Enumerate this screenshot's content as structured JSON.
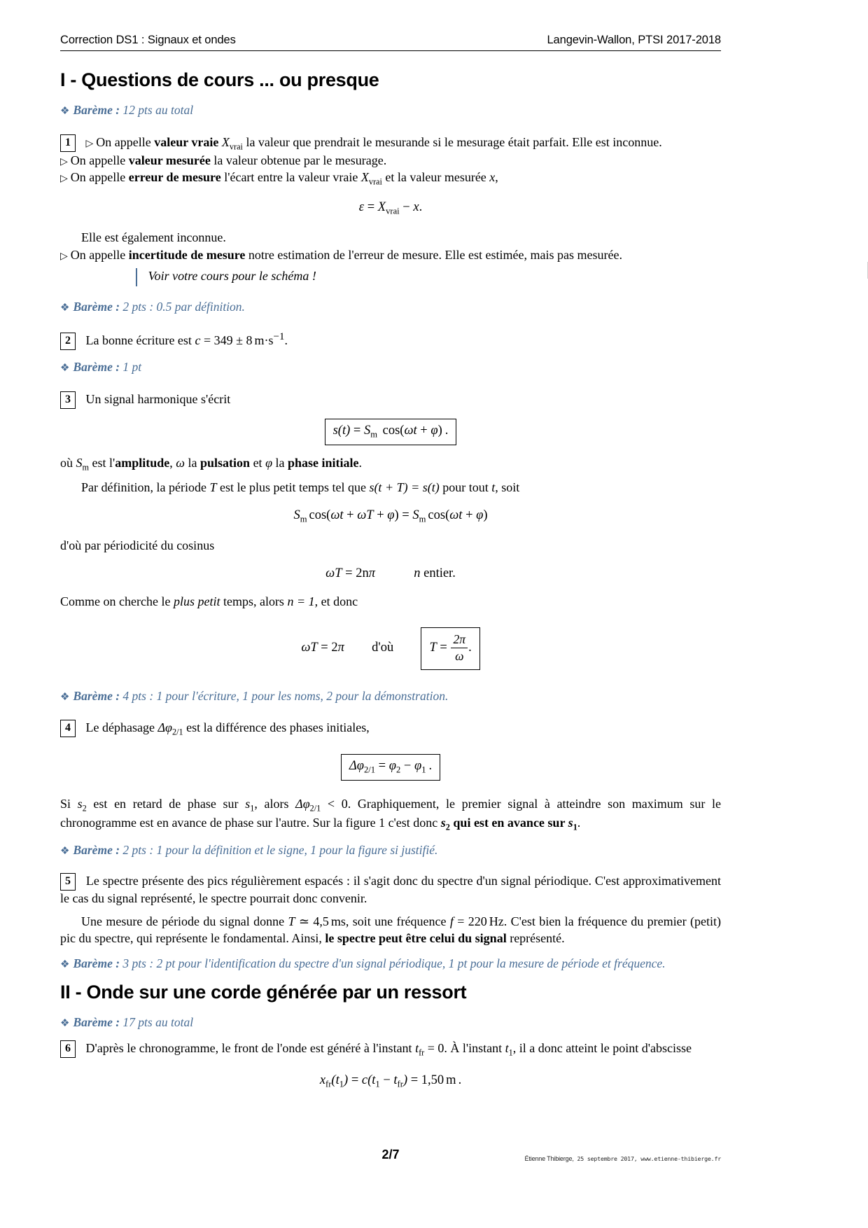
{
  "header": {
    "left": "Correction DS1 : Signaux et ondes",
    "right": "Langevin-Wallon, PTSI 2017-2018"
  },
  "sections": {
    "one": {
      "title": "I - Questions de cours ... ou presque",
      "bareme_total": {
        "label": "Barème :",
        "text": "12 pts au total"
      }
    },
    "two": {
      "title": "II - Onde sur une corde générée par un ressort",
      "bareme_total": {
        "label": "Barème :",
        "text": "17 pts au total"
      }
    }
  },
  "q1": {
    "number": "1",
    "line1_pre": "On appelle ",
    "line1_bold": "valeur vraie",
    "line1_post": " la valeur que prendrait le mesurande si le mesurage était parfait. Elle est inconnue.",
    "line1_sym_base": "X",
    "line1_sym_sub": "vrai",
    "line2_pre": "On appelle ",
    "line2_bold": "valeur mesurée",
    "line2_post": " la valeur obtenue par le mesurage.",
    "line3_pre": "On appelle ",
    "line3_bold": "erreur de mesure",
    "line3_mid": " l'écart entre la valeur vraie ",
    "line3_post": " et la valeur mesurée ",
    "line3_x": "x",
    "line3_end": ",",
    "equation": "ε = X_vrai − x .",
    "eq_eps": "ε",
    "eq_eq": "=",
    "eq_X": "X",
    "eq_Xsub": "vrai",
    "eq_minus": "−",
    "eq_x": "x",
    "eq_dot": ".",
    "after_eq": "Elle est également inconnue.",
    "line4_pre": "On appelle ",
    "line4_bold": "incertitude de mesure",
    "line4_post": " notre estimation de l'erreur de mesure. Elle est estimée, mais pas mesurée.",
    "callout": "Voir votre cours pour le schéma !",
    "bareme": {
      "label": "Barème :",
      "text": "2 pts : 0.5 par définition."
    }
  },
  "q2": {
    "number": "2",
    "text_pre": "La bonne écriture est ",
    "c": "c",
    "eq": "=",
    "value": "349 ± 8",
    "unit_m": "m",
    "unit_dot": "·",
    "unit_s": "s",
    "unit_exp": "−1",
    "period": ".",
    "bareme": {
      "label": "Barème :",
      "text": "1 pt"
    }
  },
  "q3": {
    "number": "3",
    "intro": "Un signal harmonique s'écrit",
    "boxed_eq": "s(t) = S_m cos(ωt + φ) .",
    "boxed": {
      "s": "s",
      "t1": "(t)",
      "eq": "=",
      "S": "S",
      "Ssub": "m",
      "cos": "cos(",
      "omega": "ω",
      "t2": "t",
      "plus": "+",
      "phi": "φ",
      "close": ")",
      "dot": "."
    },
    "where_pre": "où ",
    "where_S": "S",
    "where_Ssub": "m",
    "where_mid1": " est l'",
    "where_b1": "amplitude",
    "where_mid2": ", ",
    "where_omega": "ω",
    "where_mid3": " la ",
    "where_b2": "pulsation",
    "where_mid4": " et ",
    "where_phi": "φ",
    "where_mid5": " la ",
    "where_b3": "phase initiale",
    "where_end": ".",
    "def_pre": "Par définition, la période ",
    "def_T": "T",
    "def_mid": " est le plus petit temps tel que ",
    "def_eq": "s(t + T) = s(t)",
    "def_post": " pour tout ",
    "def_t": "t",
    "def_end": ", soit",
    "eq2": "S_m cos(ωt + ωT + φ) = S_m cos(ωt + φ)",
    "eq2_parts": {
      "S1": "S",
      "S1sub": "m",
      "cos1": "cos(",
      "w1": "ω",
      "t1": "t",
      "p1": "+",
      "w2": "ω",
      "T1": "T",
      "p2": "+",
      "phi1": "φ",
      "c1": ")",
      "eqs": "=",
      "S2": "S",
      "S2sub": "m",
      "cos2": "cos(",
      "w3": "ω",
      "t2": "t",
      "p3": "+",
      "phi2": "φ",
      "c2": ")"
    },
    "periodicity": "d'où par périodicité du cosinus",
    "eq3": "ωT = 2nπ        n entier.",
    "eq3_parts": {
      "w": "ω",
      "T": "T",
      "eq": "=",
      "val": "2n",
      "pi": "π",
      "n": "n",
      "entier": "entier."
    },
    "smallest_pre": "Comme on cherche le ",
    "smallest_it": "plus petit",
    "smallest_mid": " temps, alors ",
    "smallest_n": "n = 1",
    "smallest_end": ", et donc",
    "eq4_parts": {
      "w": "ω",
      "T": "T",
      "eq": "=",
      "val": "2",
      "pi": "π",
      "dou": "d'où",
      "Tb": "T",
      "eqb": "=",
      "num": "2π",
      "den": "ω",
      "dot": "."
    },
    "bareme": {
      "label": "Barème :",
      "text": "4 pts : 1 pour l'écriture, 1 pour les noms, 2 pour la démonstration."
    }
  },
  "q4": {
    "number": "4",
    "intro_pre": "Le déphasage ",
    "intro_sym": "Δφ",
    "intro_sub": "2/1",
    "intro_post": " est la différence des phases initiales,",
    "boxed_eq": "Δφ_2/1 = φ_2 − φ_1 .",
    "boxed": {
      "dphi": "Δφ",
      "dsub": "2/1",
      "eq": "=",
      "phi2": "φ",
      "sub2": "2",
      "minus": "−",
      "phi1": "φ",
      "sub1": "1",
      "dot": "."
    },
    "para": "Si s2 est en retard de phase sur s1, alors Δφ2/1 < 0. Graphiquement, le premier signal à atteindre son maximum sur le chronogramme est en avance de phase sur l'autre. Sur la figure 1 c'est donc s2 qui est en avance sur s1.",
    "p_pre": "Si ",
    "p_s2": "s",
    "p_s2sub": "2",
    "p_mid1": " est en retard de phase sur ",
    "p_s1": "s",
    "p_s1sub": "1",
    "p_mid2": ", alors ",
    "p_dphi": "Δφ",
    "p_dsub": "2/1",
    "p_lt": " < 0",
    "p_mid3": ". Graphiquement, le premier signal à atteindre son maximum sur le chronogramme est en avance de phase sur l'autre. Sur la figure 1 c'est donc ",
    "p_b_s2": "s",
    "p_b_s2sub": "2",
    "p_b_mid": " qui est en avance sur ",
    "p_b_s1": "s",
    "p_b_s1sub": "1",
    "p_end": ".",
    "bareme": {
      "label": "Barème :",
      "text": "2 pts : 1 pour la définition et le signe, 1 pour la figure si justifié."
    }
  },
  "q5": {
    "number": "5",
    "para1": "Le spectre présente des pics régulièrement espacés : il s'agit donc du spectre d'un signal périodique. C'est approximativement le cas du signal représenté, le spectre pourrait donc convenir.",
    "para2_pre": "Une mesure de période du signal donne ",
    "para2_T": "T",
    "para2_simeq": "≃",
    "para2_val": "4,5",
    "para2_ms": "ms",
    "para2_mid": ", soit une fréquence ",
    "para2_f": "f",
    "para2_eq": "=",
    "para2_fval": "220",
    "para2_hz": "Hz",
    "para2_mid2": ". C'est bien la fréquence du premier (petit) pic du spectre, qui représente le fondamental. Ainsi, ",
    "para2_bold": "le spectre peut être celui du signal",
    "para2_end": " représenté.",
    "bareme": {
      "label": "Barème :",
      "text": "3 pts : 2 pt pour l'identification du spectre d'un signal périodique, 1 pt pour la mesure de période et fréquence."
    }
  },
  "q6": {
    "number": "6",
    "text_pre": "D'après le chronogramme, le front de l'onde est généré à l'instant ",
    "t_fr": "t",
    "t_fr_sub": "fr",
    "text_mid": " = 0. À l'instant ",
    "t_1": "t",
    "t_1_sub": "1",
    "text_post": ", il a donc atteint le point d'abscisse",
    "equation": "x_fr(t_1) = c(t_1 − t_fr) = 1,50 m .",
    "eq_parts": {
      "x": "x",
      "xsub": "fr",
      "open": "(",
      "t1": "t",
      "t1sub": "1",
      "close": ")",
      "eq1": "=",
      "c": "c",
      "open2": "(",
      "t2": "t",
      "t2sub": "1",
      "minus": "−",
      "t3": "t",
      "t3sub": "fr",
      "close2": ")",
      "eq2": "=",
      "val": "1,50",
      "unit": "m",
      "dot": "."
    }
  },
  "footer": {
    "page": "2/7",
    "credit_name": "Étienne Thibierge,",
    "credit_date": " 25 septembre 2017,",
    "credit_url": " www.etienne-thibierge.fr"
  },
  "colors": {
    "bareme": "#4a6e96",
    "text": "#000000",
    "rule": "#000000"
  }
}
